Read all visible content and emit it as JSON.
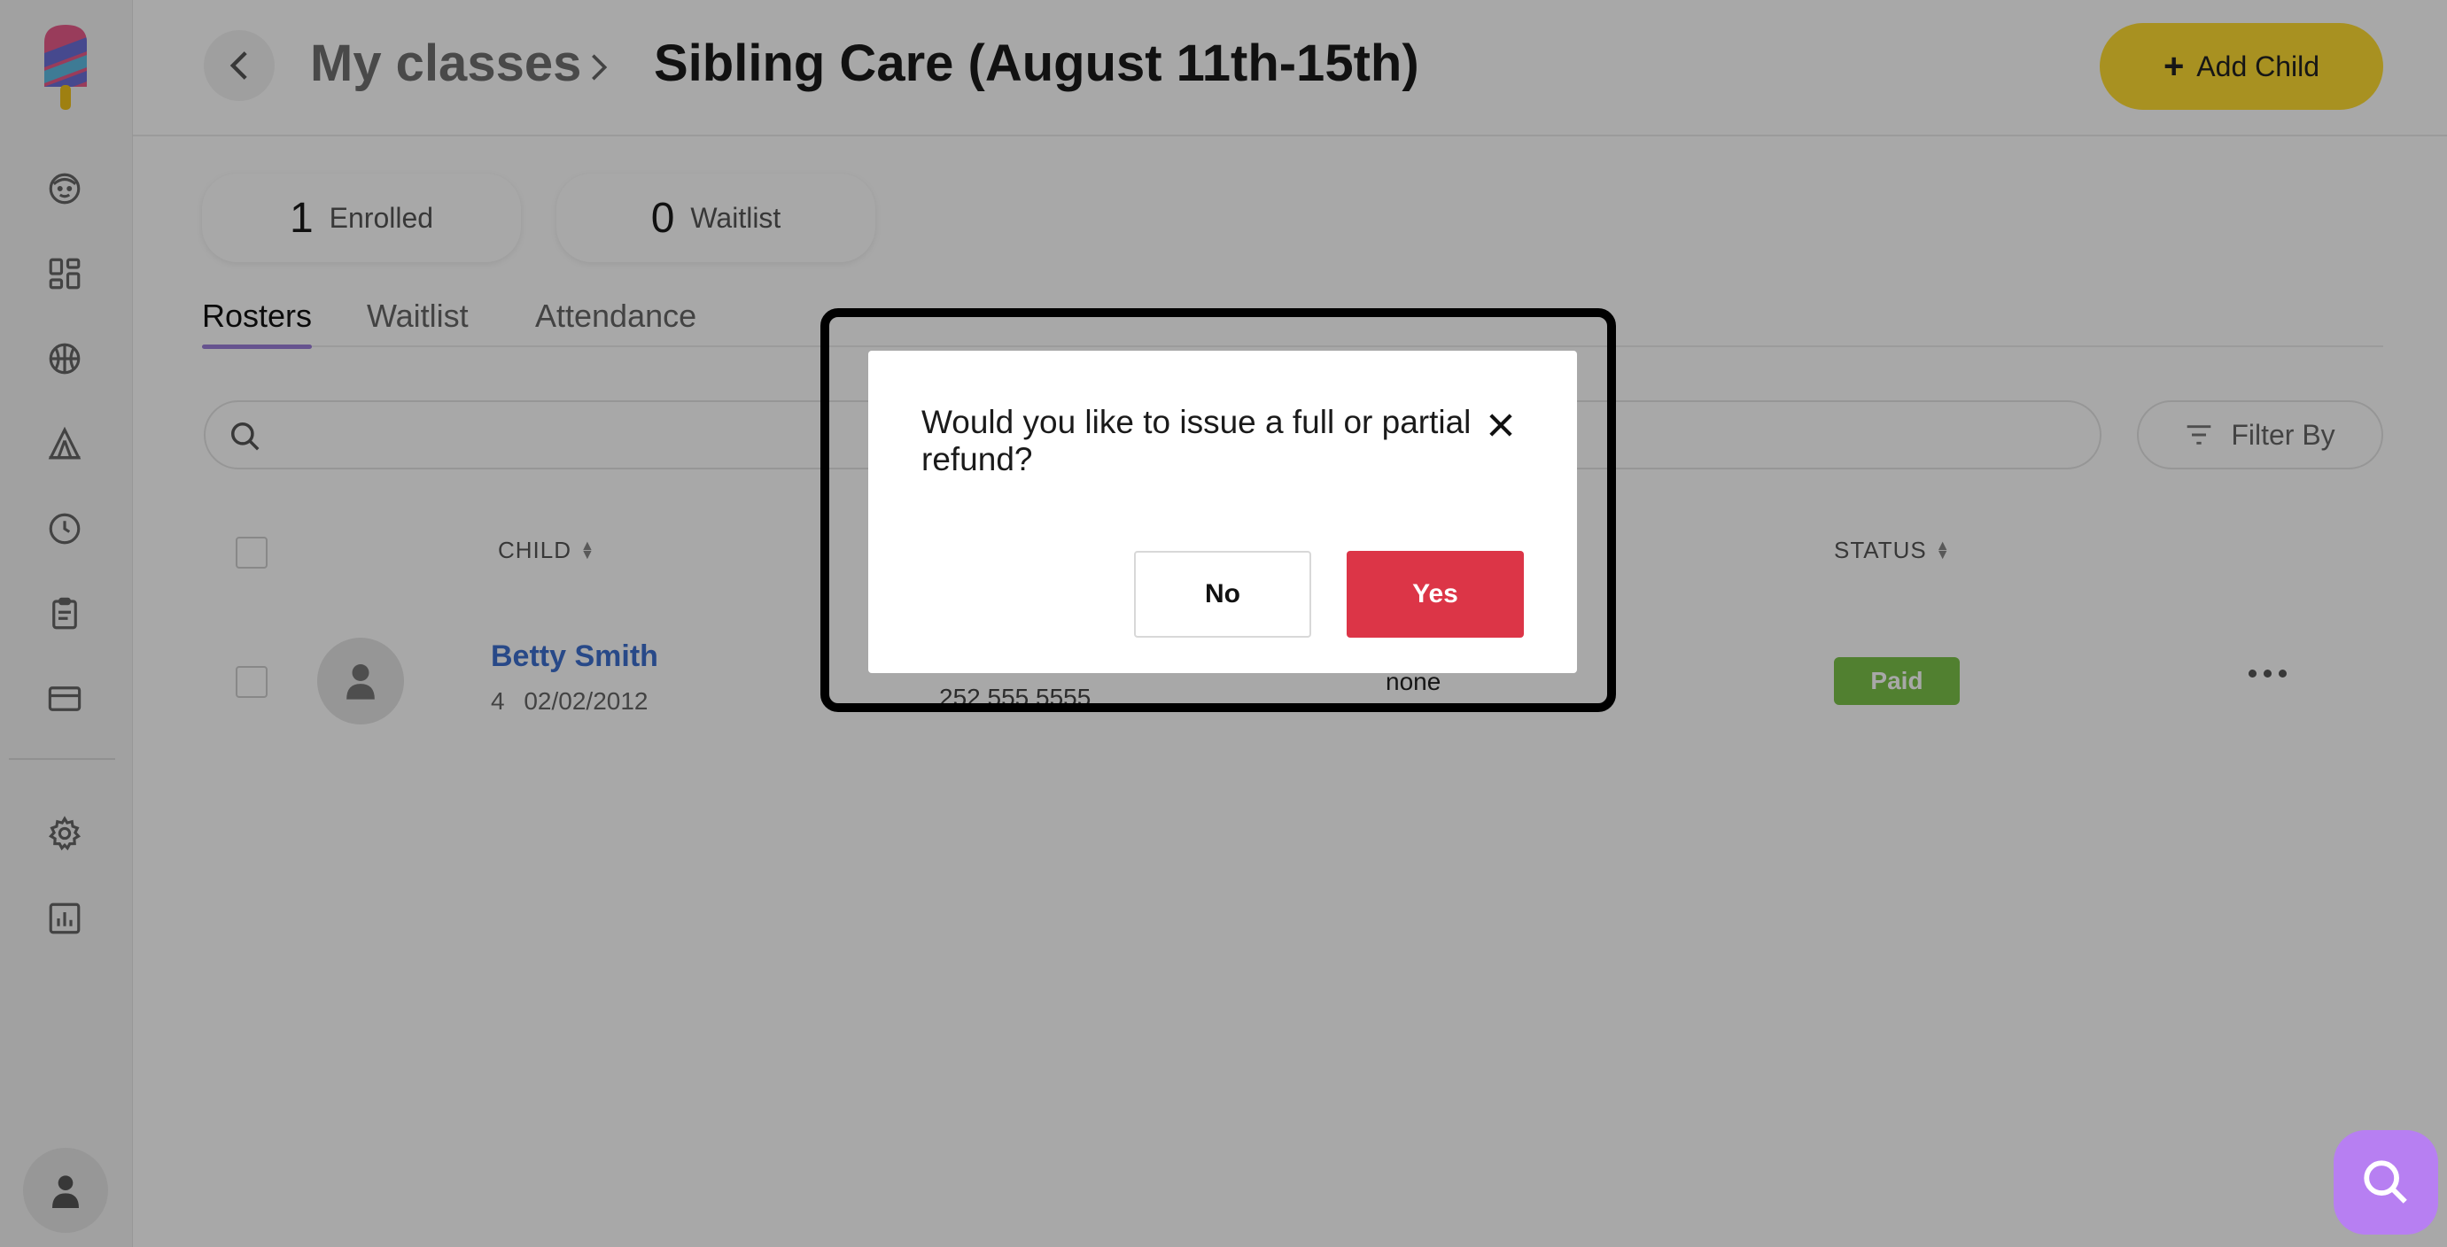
{
  "header": {
    "breadcrumb_parent": "My classes",
    "title": "Sibling Care (August 11th-15th)",
    "add_child_label": "Add Child"
  },
  "stats": [
    {
      "value": "1",
      "label": "Enrolled"
    },
    {
      "value": "0",
      "label": "Waitlist"
    }
  ],
  "tabs": [
    {
      "label": "Rosters",
      "active": true
    },
    {
      "label": "Waitlist",
      "active": false
    },
    {
      "label": "Attendance",
      "active": false
    }
  ],
  "search": {
    "placeholder": ""
  },
  "filter": {
    "label": "Filter By"
  },
  "table": {
    "columns": {
      "child": "CHILD",
      "status": "STATUS"
    },
    "rows": [
      {
        "name": "Betty Smith",
        "age": "4",
        "dob": "02/02/2012",
        "phone": "252 555 5555",
        "other": "none",
        "status": "Paid"
      }
    ]
  },
  "sidebar": {
    "icons": [
      "child-face-icon",
      "dashboard-icon",
      "sports-ball-icon",
      "camp-tent-icon",
      "clock-icon",
      "clipboard-icon",
      "credit-card-icon",
      "settings-gear-icon",
      "reports-chart-icon"
    ]
  },
  "modal": {
    "message": "Would you like to issue a full or partial refund?",
    "no_label": "No",
    "yes_label": "Yes"
  },
  "colors": {
    "accent_yellow": "#ffdd33",
    "tab_underline": "#9b7ed9",
    "link_blue": "#3d6fcf",
    "paid_green": "#7bc34a",
    "danger_red": "#dc3547",
    "help_purple": "#b77ff2"
  }
}
